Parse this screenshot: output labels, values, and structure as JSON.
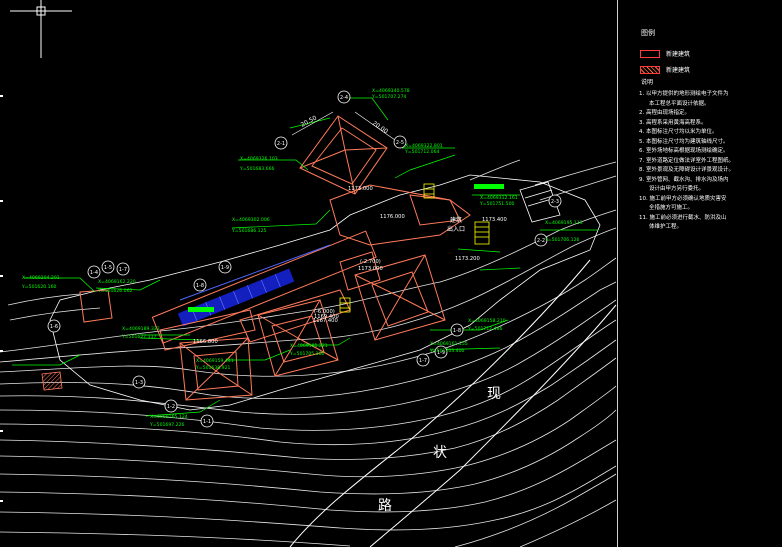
{
  "colors": {
    "background": "#000000",
    "contour": "#ffffff",
    "building_new": "#ff7a5a",
    "grid_marker": "#00ff00",
    "road": "#ffffff",
    "solar": "#3a50ff",
    "highlight": "#ffff00",
    "note_text": "#ffffff"
  },
  "legend": {
    "title": "图例",
    "items": [
      {
        "label": "新建建筑",
        "style": "outline"
      },
      {
        "label": "新建建筑",
        "style": "hatch"
      }
    ]
  },
  "notes": {
    "title": "说明",
    "lines": [
      {
        "text": "1. 以甲方提供的地形测绘电子文件为",
        "sub": false
      },
      {
        "text": "本工程总平面设计依据。",
        "sub": true
      },
      {
        "text": "2. 高程由现场指定。",
        "sub": false
      },
      {
        "text": "3. 高程系采用黄海高程系。",
        "sub": false
      },
      {
        "text": "4. 本图标注尺寸均以米为单位。",
        "sub": false
      },
      {
        "text": "5. 本图标注尺寸均为建筑轴线尺寸。",
        "sub": false
      },
      {
        "text": "6. 室外场地标高根据现场测绘确定。",
        "sub": false
      },
      {
        "text": "7. 室外道路定位做法详室外工程图纸。",
        "sub": false
      },
      {
        "text": "8. 室外景观及无障碍设计详景观设计。",
        "sub": false
      },
      {
        "text": "9. 室外管网、截水沟、排水沟及场内",
        "sub": false
      },
      {
        "text": "设计由甲方另行委托。",
        "sub": true
      },
      {
        "text": "10. 施工前甲方必须确认地质灾害安",
        "sub": false
      },
      {
        "text": "全措施方可施工。",
        "sub": true
      },
      {
        "text": "11. 施工前必须进行截水、防洪及山",
        "sub": false
      },
      {
        "text": "体维护工程。",
        "sub": true
      }
    ]
  },
  "road_label": [
    "现",
    "状",
    "路"
  ],
  "elevations": [
    "1176.000",
    "1173.000",
    "1173.400",
    "1173.200",
    "1169.400",
    "1166.800",
    "1167.400",
    "1173.000"
  ],
  "elevation_brackets": [
    "(-2.700)",
    "(-6.000)"
  ],
  "entrance_label": [
    "建筑",
    "出入口"
  ],
  "grid_markers": [
    "2-4",
    "2-5",
    "2-1",
    "1-9",
    "1-8",
    "1-7",
    "1-4",
    "1-5",
    "1-6",
    "1-3",
    "1-2",
    "1-1",
    "2-3",
    "2-2"
  ],
  "coordinates": [
    {
      "x": "X=4069340.578",
      "y": "Y=501707.274"
    },
    {
      "x": "X=4069326.103",
      "y": "Y=501683.666"
    },
    {
      "x": "X=4069322.801",
      "y": "Y=501712.064"
    },
    {
      "x": "X=4069302.006",
      "y": "Y=501686.125"
    },
    {
      "x": "X=4069312.161",
      "y": "Y=501751.500"
    },
    {
      "x": "X=4069195.113",
      "y": "Y=501706.126"
    },
    {
      "x": "X=4069204.201",
      "y": "Y=501620.160"
    },
    {
      "x": "X=4069162.220",
      "y": "Y=501626.062"
    },
    {
      "x": "X=4069189.322",
      "y": "Y=501627.117"
    },
    {
      "x": "X=4069181.221",
      "y": "Y=501705.160"
    },
    {
      "x": "X=4069161.155",
      "y": "Y=501703.400"
    },
    {
      "x": "X=4069158.210",
      "y": "Y=501712.486"
    },
    {
      "x": "X=4069159.441",
      "y": "Y=501638.921"
    },
    {
      "x": "X=4069165.124",
      "y": "Y=501697.226"
    }
  ],
  "dimensions": [
    "20.50",
    "20.00"
  ]
}
